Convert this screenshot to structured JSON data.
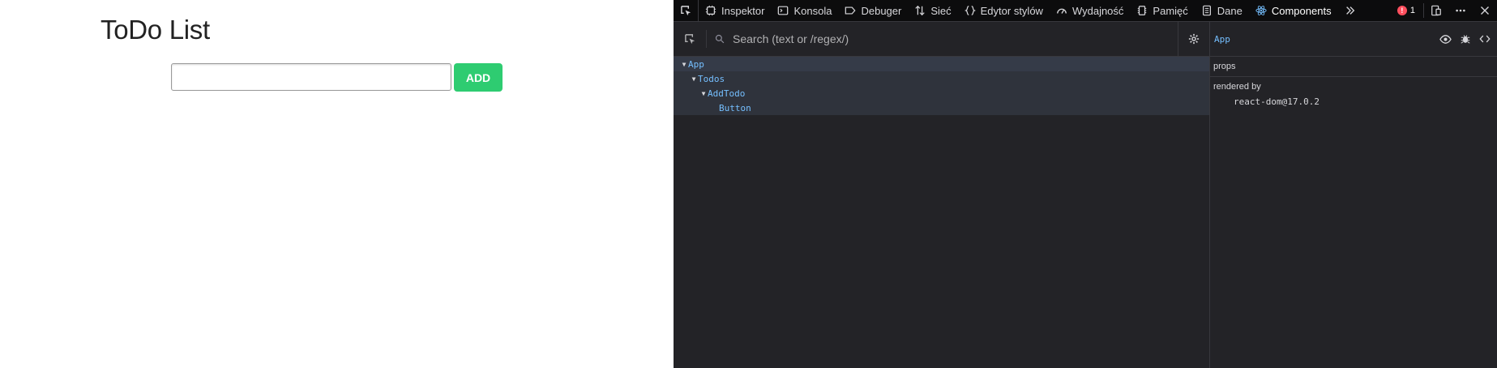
{
  "app": {
    "title": "ToDo List",
    "add_button_label": "ADD",
    "input_value": ""
  },
  "devtools": {
    "tabs": [
      {
        "label": "Inspektor",
        "icon": "inspector-icon"
      },
      {
        "label": "Konsola",
        "icon": "console-icon"
      },
      {
        "label": "Debuger",
        "icon": "debugger-icon"
      },
      {
        "label": "Sieć",
        "icon": "network-icon"
      },
      {
        "label": "Edytor stylów",
        "icon": "style-editor-icon"
      },
      {
        "label": "Wydajność",
        "icon": "performance-icon"
      },
      {
        "label": "Pamięć",
        "icon": "memory-icon"
      },
      {
        "label": "Dane",
        "icon": "storage-icon"
      },
      {
        "label": "Components",
        "icon": "react-icon",
        "active": true
      }
    ],
    "error_count": "1",
    "search_placeholder": "Search (text or /regex/)",
    "tree": [
      {
        "label": "App",
        "depth": 0,
        "expanded": true,
        "selected": true
      },
      {
        "label": "Todos",
        "depth": 1,
        "expanded": true
      },
      {
        "label": "AddTodo",
        "depth": 2,
        "expanded": true
      },
      {
        "label": "Button",
        "depth": 3,
        "expanded": false
      }
    ],
    "selected_component": "App",
    "props_label": "props",
    "rendered_by_label": "rendered by",
    "renderer": "react-dom@17.0.2",
    "colors": {
      "accent": "#75bfff",
      "add_button": "#2ecc71",
      "error": "#ff4f5e"
    }
  }
}
